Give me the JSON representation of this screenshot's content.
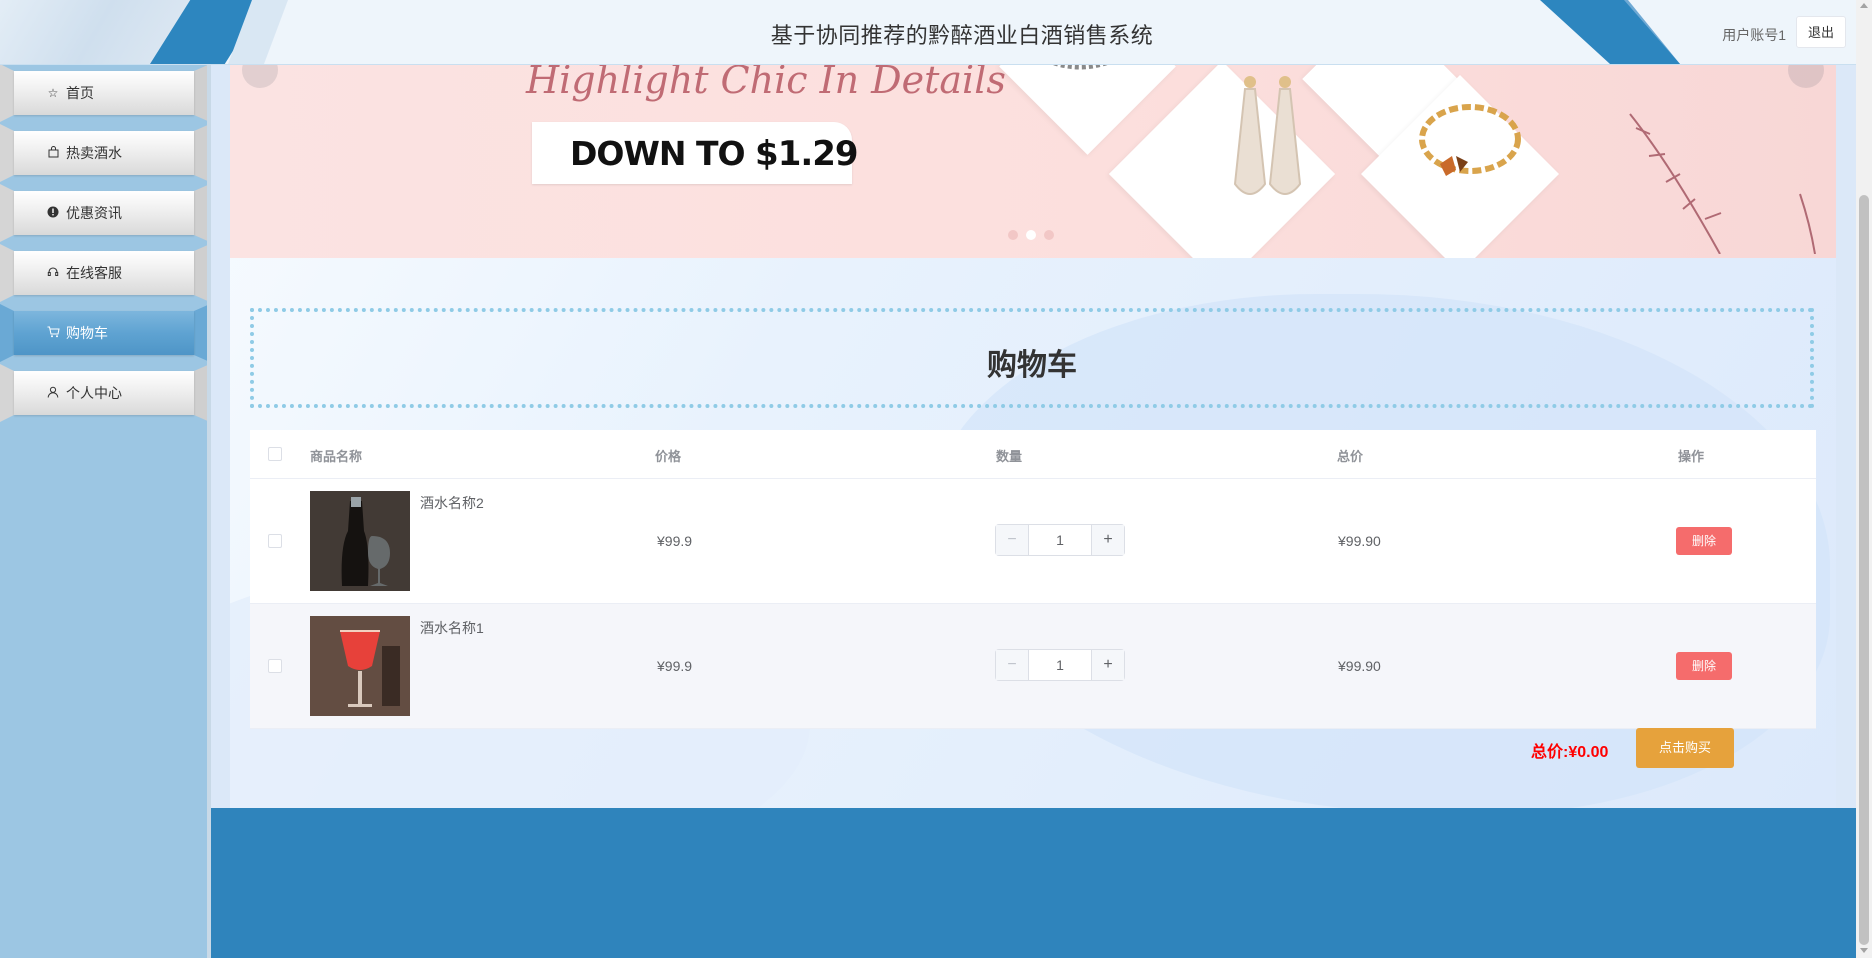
{
  "app": {
    "title": "基于协同推荐的黔醉酒业白酒销售系统",
    "user_label": "用户账号1",
    "logout_label": "退出"
  },
  "sidebar": {
    "items": [
      {
        "label": "首页",
        "icon": "star-icon",
        "active": false
      },
      {
        "label": "热卖酒水",
        "icon": "shopping-bag-icon",
        "active": false
      },
      {
        "label": "优惠资讯",
        "icon": "info-circle-icon",
        "active": false
      },
      {
        "label": "在线客服",
        "icon": "headset-icon",
        "active": false
      },
      {
        "label": "购物车",
        "icon": "cart-icon",
        "active": true
      },
      {
        "label": "个人中心",
        "icon": "user-icon",
        "active": false
      }
    ]
  },
  "banner": {
    "script_text": "Highlight Chic In Details",
    "promo_prefix": "DOWN TO",
    "promo_price": "$1.29",
    "active_slide": 2,
    "slide_count": 3
  },
  "cart": {
    "title": "购物车",
    "columns": [
      "商品名称",
      "价格",
      "数量",
      "总价",
      "操作"
    ],
    "rows": [
      {
        "name": "酒水名称2",
        "price": "¥99.9",
        "quantity": "1",
        "total": "¥99.90",
        "action": "删除"
      },
      {
        "name": "酒水名称1",
        "price": "¥99.9",
        "quantity": "1",
        "total": "¥99.90",
        "action": "删除"
      }
    ],
    "total_label": "总价:",
    "total_value": "¥0.00",
    "buy_label": "点击购买"
  },
  "colors": {
    "accent_blue": "#2f84bc",
    "sidebar_blue": "#9cc6e3",
    "delete_red": "#f56c6c",
    "buy_orange": "#e6a23c",
    "total_red": "#ff0000"
  }
}
